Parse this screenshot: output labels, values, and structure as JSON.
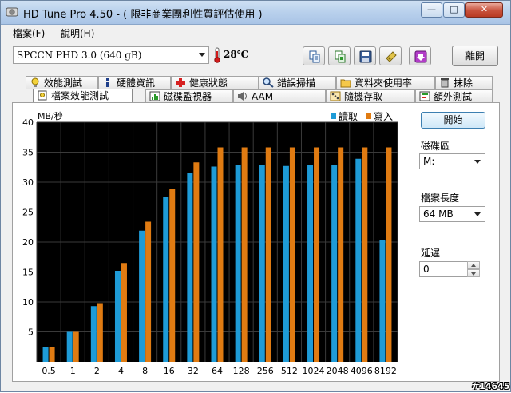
{
  "window": {
    "title": "HD Tune Pro 4.50 - ( 限非商業團利性質評估使用 )",
    "min_glyph": "—",
    "max_glyph": "□",
    "close_glyph": "✕"
  },
  "menu": [
    {
      "label": "檔案(F)"
    },
    {
      "label": "說明(H)"
    }
  ],
  "toolbar": {
    "drive": "SPCCN   PHD 3.0 (640 gB)",
    "temperature": "28℃",
    "buttons": [
      "copy-text-icon",
      "copy-screen-icon",
      "save-icon",
      "options-icon",
      "download-icon"
    ],
    "exit_label": "離開"
  },
  "tabs_row1": [
    {
      "label": "效能測試",
      "icon": "benchmark-icon"
    },
    {
      "label": "硬體資訊",
      "icon": "info-icon"
    },
    {
      "label": "健康狀態",
      "icon": "health-icon"
    },
    {
      "label": "錯誤掃描",
      "icon": "scan-icon"
    },
    {
      "label": "資料夾使用率",
      "icon": "folder-icon"
    },
    {
      "label": "抹除",
      "icon": "erase-icon"
    }
  ],
  "tabs_row2": [
    {
      "label": "檔案效能測試",
      "icon": "file-benchmark-icon",
      "active": true
    },
    {
      "label": "磁碟監視器",
      "icon": "monitor-icon"
    },
    {
      "label": "AAM",
      "icon": "speaker-icon"
    },
    {
      "label": "隨機存取",
      "icon": "random-access-icon"
    },
    {
      "label": "額外測試",
      "icon": "extra-tests-icon"
    }
  ],
  "controls": {
    "start_label": "開始",
    "partition_label": "磁碟區",
    "partition_value": "M:",
    "file_length_label": "檔案長度",
    "file_length_value": "64 MB",
    "delay_label": "延遲",
    "delay_value": "0"
  },
  "watermark": "#14645",
  "colors": {
    "read": "#1e9bd7",
    "write": "#e07b12",
    "plot_bg": "#000000",
    "grid": "#3a3a3a"
  },
  "chart_data": {
    "type": "bar",
    "ylabel": "MB/秒",
    "ylim": [
      0,
      40
    ],
    "yticks": [
      5,
      10,
      15,
      20,
      25,
      30,
      35,
      40
    ],
    "legend_position": "top-right",
    "categories": [
      "0.5",
      "1",
      "2",
      "4",
      "8",
      "16",
      "32",
      "64",
      "128",
      "256",
      "512",
      "1024",
      "2048",
      "4096",
      "8192"
    ],
    "series": [
      {
        "name": "讀取",
        "values": [
          2.4,
          5.0,
          9.3,
          15.2,
          21.9,
          27.5,
          31.5,
          32.6,
          32.9,
          32.9,
          32.7,
          32.9,
          32.9,
          33.9,
          20.4
        ]
      },
      {
        "name": "寫入",
        "values": [
          2.5,
          5.0,
          9.8,
          16.5,
          23.4,
          28.8,
          33.3,
          35.8,
          35.8,
          35.8,
          35.8,
          35.8,
          35.8,
          35.8,
          35.8
        ]
      }
    ]
  }
}
